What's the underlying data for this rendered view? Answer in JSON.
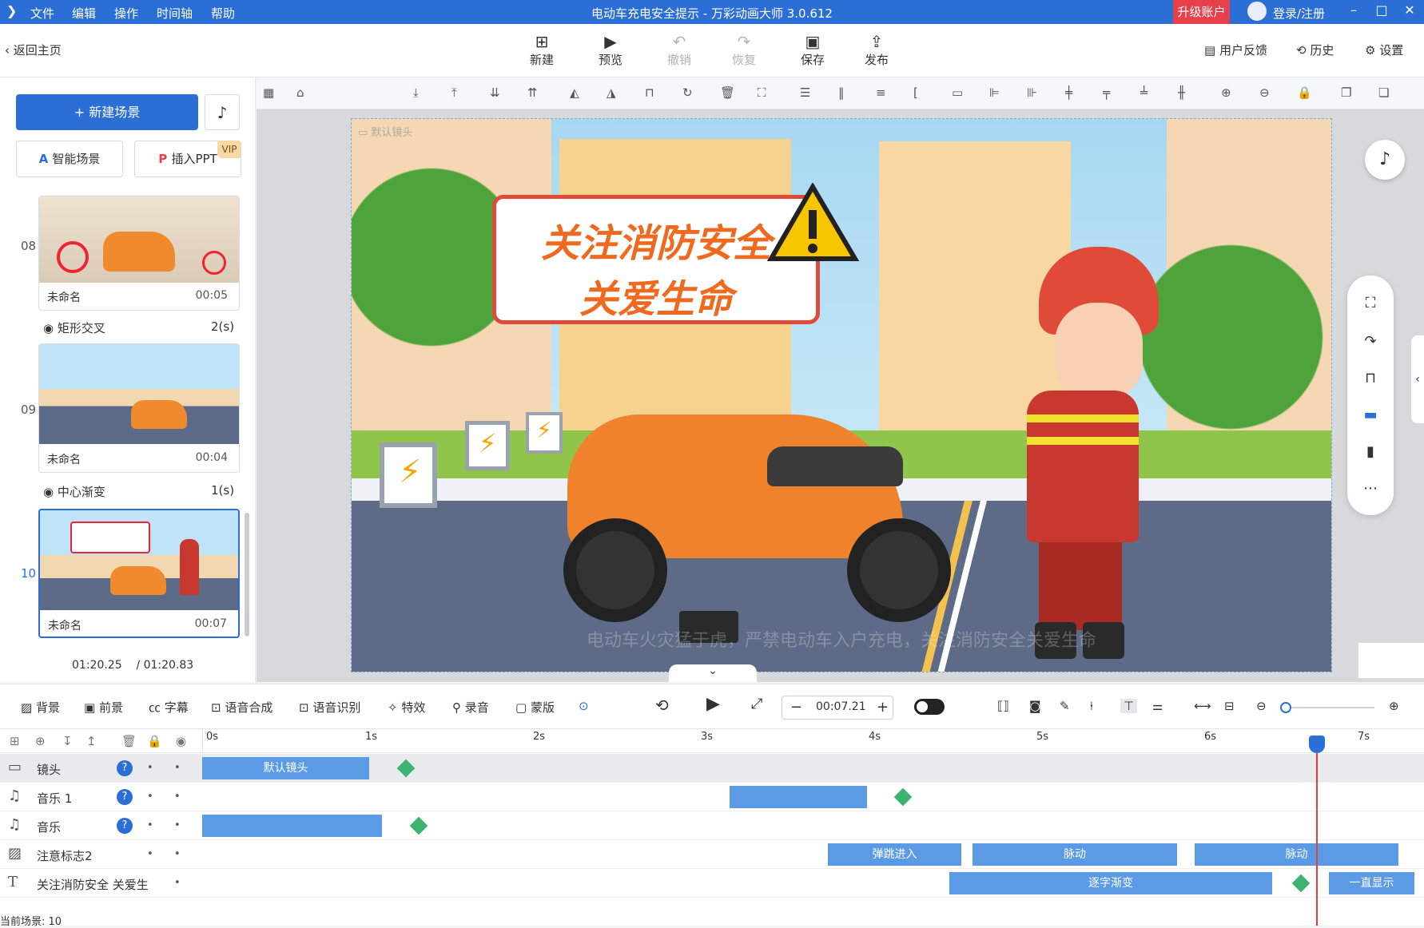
{
  "app": {
    "title": "电动车充电安全提示 - 万彩动画大师 3.0.612",
    "upgrade": "升级账户",
    "login": "登录/注册"
  },
  "menu": [
    "文件",
    "编辑",
    "操作",
    "时间轴",
    "帮助"
  ],
  "toolbar": {
    "back": "返回主页",
    "buttons": [
      {
        "label": "新建",
        "icon": "new-icon"
      },
      {
        "label": "预览",
        "icon": "play-icon"
      },
      {
        "label": "撤销",
        "icon": "undo-icon"
      },
      {
        "label": "恢复",
        "icon": "redo-icon"
      },
      {
        "label": "保存",
        "icon": "save-icon"
      },
      {
        "label": "发布",
        "icon": "publish-icon"
      }
    ],
    "feedback": "用户反馈",
    "history": "历史",
    "settings": "设置"
  },
  "left": {
    "new_scene": "+ 新建场景",
    "smart_scene": "智能场景",
    "insert_ppt": "插入PPT",
    "vip": "VIP",
    "scenes": [
      {
        "num": "08",
        "name": "未命名",
        "dur": "00:05"
      },
      {
        "num": "09",
        "name": "未命名",
        "dur": "00:04"
      },
      {
        "num": "10",
        "name": "未命名",
        "dur": "00:07"
      }
    ],
    "transitions": [
      {
        "name": "矩形交叉",
        "dur": "2(s)"
      },
      {
        "name": "中心渐变",
        "dur": "1(s)"
      }
    ],
    "time_current": "01:20.25",
    "time_total": "/ 01:20.83"
  },
  "stage": {
    "camera": "默认镜头",
    "headline1": "关注消防安全",
    "headline2": "关爱生命",
    "subtitle": "电动车火灾猛于虎，严禁电动车入户充电，关注消防安全关爱生命"
  },
  "ctrl": {
    "items": [
      "背景",
      "前景",
      "字幕",
      "语音合成",
      "语音识别",
      "特效",
      "录音",
      "蒙版"
    ],
    "time": "00:07.21"
  },
  "timeline": {
    "ticks": [
      "0s",
      "1s",
      "2s",
      "3s",
      "4s",
      "5s",
      "6s",
      "7s"
    ],
    "tracks": [
      {
        "name": "镜头",
        "icon": "camera-icon"
      },
      {
        "name": "音乐 1",
        "icon": "music-icon"
      },
      {
        "name": "音乐",
        "icon": "music-icon"
      },
      {
        "name": "注意标志2",
        "icon": "image-icon"
      },
      {
        "name": "关注消防安全 关爱生",
        "icon": "text-icon"
      }
    ],
    "clips": {
      "camera": "默认镜头",
      "bounce": "弹跳进入",
      "pulse1": "脉动",
      "pulse2": "脉动",
      "typewriter": "逐字渐变",
      "always": "一直显示"
    },
    "footer": "当前场景: 10"
  }
}
